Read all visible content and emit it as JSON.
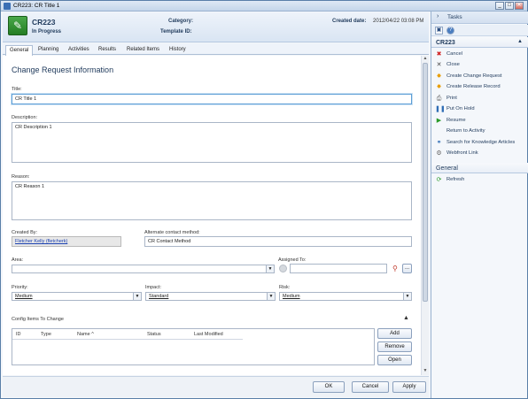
{
  "window": {
    "title": "CR223: CR Title 1",
    "min": "_",
    "max": "□",
    "close": "✕"
  },
  "header": {
    "id": "CR223",
    "status": "In Progress",
    "category_label": "Category:",
    "template_label": "Template ID:",
    "created_label": "Created date:",
    "created_value": "2012/04/22 03:08 PM"
  },
  "tabs": [
    "General",
    "Planning",
    "Activities",
    "Results",
    "Related Items",
    "History"
  ],
  "form": {
    "heading": "Change Request Information",
    "title_label": "Title:",
    "title_value": "CR Title 1",
    "description_label": "Description:",
    "description_value": "CR Description 1",
    "reason_label": "Reason:",
    "reason_value": "CR Reason 1",
    "created_by_label": "Created By:",
    "created_by_value": "Fletcher Kelly (fletcherk)",
    "alt_contact_label": "Alternate contact method:",
    "alt_contact_value": "CR Contact Method",
    "area_label": "Area:",
    "area_value": "",
    "assigned_label": "Assigned To:",
    "assigned_value": "",
    "priority_label": "Priority:",
    "priority_value": "Medium",
    "impact_label": "Impact:",
    "impact_value": "Standard",
    "risk_label": "Risk:",
    "risk_value": "Medium",
    "config_label": "Config Items To Change",
    "grid_columns": [
      "ID",
      "Type",
      "Name ^",
      "Status",
      "Last Modified"
    ],
    "grid_buttons": [
      "Add",
      "Remove",
      "Open"
    ],
    "ellipsis": "..."
  },
  "footer": {
    "ok": "OK",
    "cancel": "Cancel",
    "apply": "Apply"
  },
  "tasks": {
    "title": "Tasks",
    "section_cr": "CR223",
    "items": [
      "Cancel",
      "Close",
      "Create Change Request",
      "Create Release Record",
      "Print",
      "Put On Hold",
      "Resume",
      "Return to Activity",
      "Search for Knowledge Articles",
      "Webfront Link"
    ],
    "section_general": "General",
    "general_items": [
      "Refresh"
    ]
  }
}
